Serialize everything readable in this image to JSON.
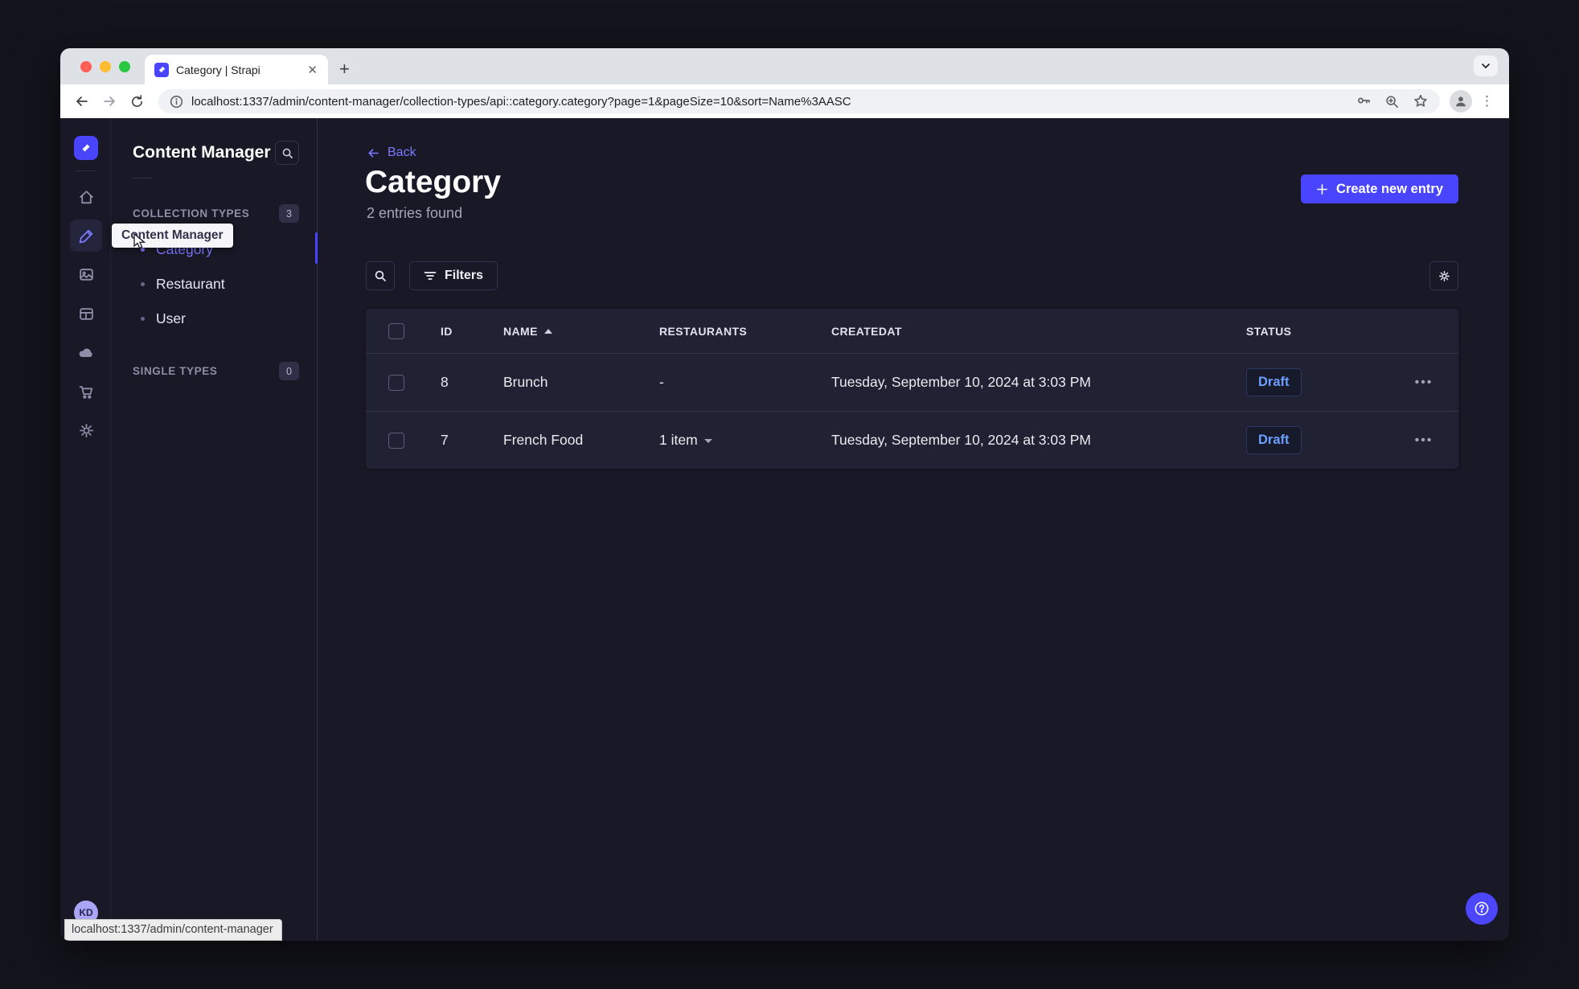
{
  "browser": {
    "tab_title": "Category | Strapi",
    "url": "localhost:1337/admin/content-manager/collection-types/api::category.category?page=1&pageSize=10&sort=Name%3AASC",
    "status_bar": "localhost:1337/admin/content-manager",
    "menu_dots": "⋮",
    "new_tab": "+",
    "close_tab": "✕"
  },
  "sidebar": {
    "tooltip": "Content Manager",
    "avatar_initials": "KD"
  },
  "subnav": {
    "title": "Content Manager",
    "collection_section": {
      "label": "COLLECTION TYPES",
      "count": "3"
    },
    "single_section": {
      "label": "SINGLE TYPES",
      "count": "0"
    },
    "items": [
      {
        "label": "Category"
      },
      {
        "label": "Restaurant"
      },
      {
        "label": "User"
      }
    ]
  },
  "main": {
    "back_label": "Back",
    "title": "Category",
    "subtitle": "2 entries found",
    "create_button": "Create new entry",
    "filters_button": "Filters",
    "row_actions": "•••",
    "table": {
      "headers": [
        "ID",
        "NAME",
        "RESTAURANTS",
        "CREATEDAT",
        "STATUS"
      ],
      "rows": [
        {
          "id": "8",
          "name": "Brunch",
          "restaurants": "-",
          "created": "Tuesday, September 10, 2024 at 3:03 PM",
          "status": "Draft"
        },
        {
          "id": "7",
          "name": "French Food",
          "restaurants": "1 item",
          "created": "Tuesday, September 10, 2024 at 3:03 PM",
          "status": "Draft"
        }
      ]
    }
  },
  "colors": {
    "primary": "#4945ff",
    "link": "#7b79ff",
    "app_background": "#181826",
    "card_background": "#212134",
    "border": "#32324d",
    "muted_text": "#a5a5ba",
    "draft_text": "#6e9eff"
  }
}
